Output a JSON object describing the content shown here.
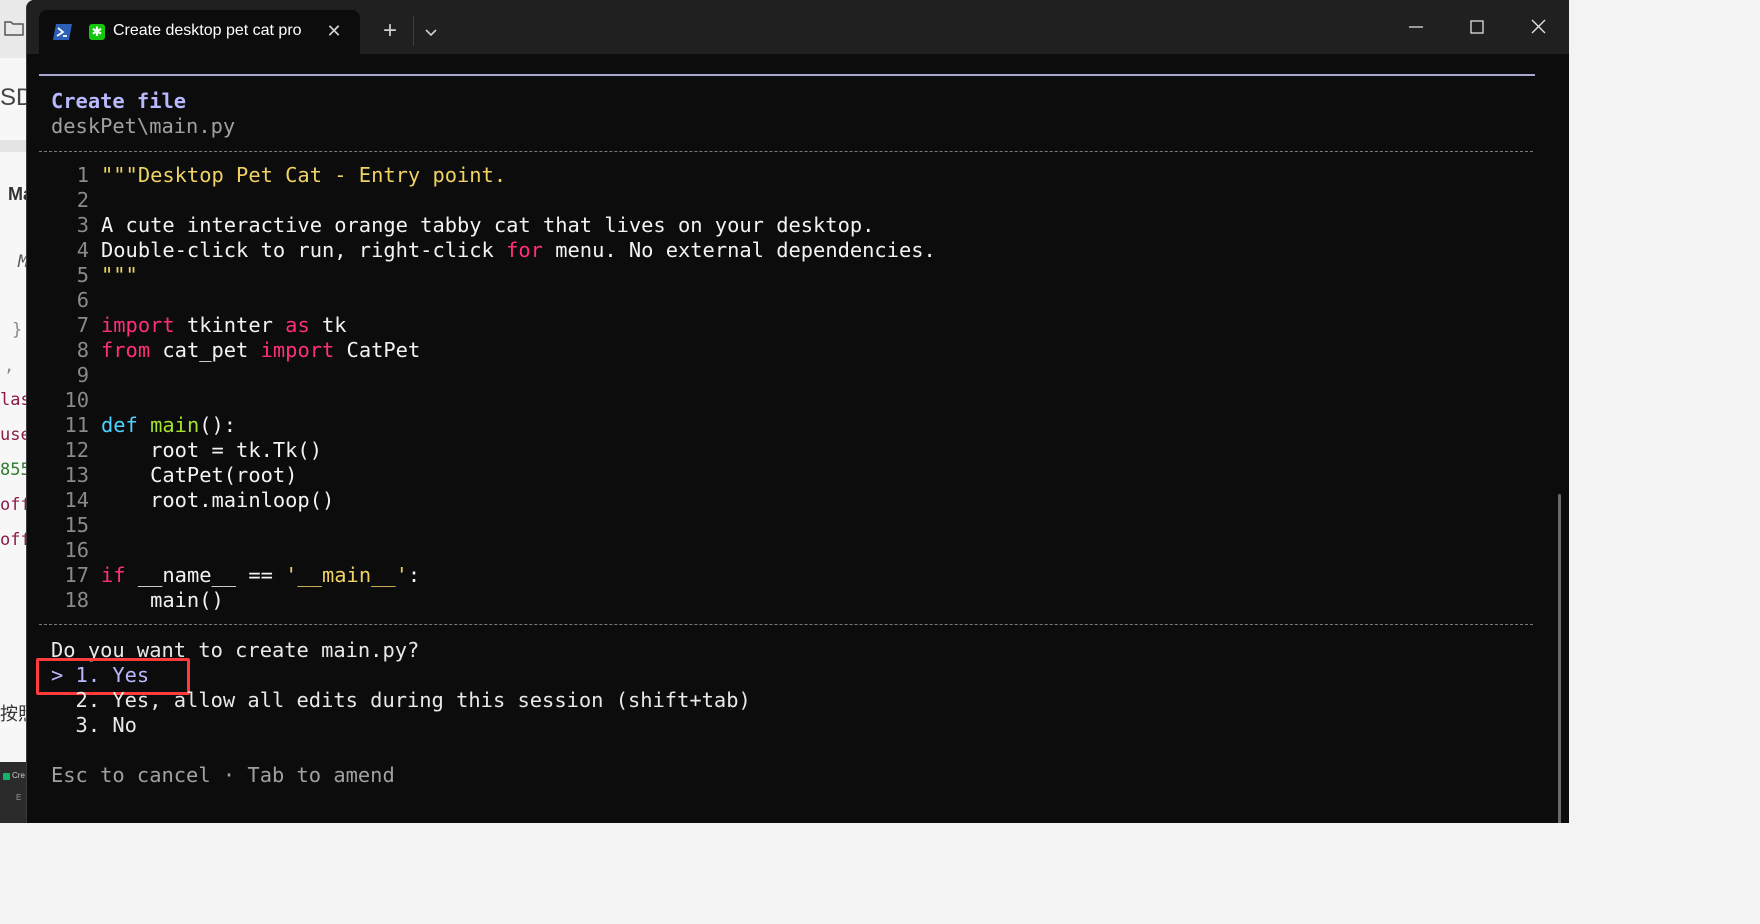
{
  "background_app": {
    "texts": [
      "SD",
      "Ma",
      "M",
      "}",
      ",",
      "las",
      "use",
      "855",
      "off",
      "off",
      "按照",
      "Cre",
      "E"
    ]
  },
  "window": {
    "tab_title": "Create desktop pet cat pro",
    "tab_icon": "powershell-icon",
    "app_icon": "✱",
    "close_tab_glyph": "✕",
    "new_tab_glyph": "+"
  },
  "prompt": {
    "header_title": "Create file",
    "header_path": "deskPet\\main.py",
    "question": "Do you want to create main.py?",
    "options": [
      "> 1. Yes",
      "  2. Yes, allow all edits during this session (shift+tab)",
      "  3. No"
    ],
    "footer": "Esc to cancel · Tab to amend"
  },
  "code": {
    "line_numbers": [
      "1",
      "2",
      "3",
      "4",
      "5",
      "6",
      "7",
      "8",
      "9",
      "10",
      "11",
      "12",
      "13",
      "14",
      "15",
      "16",
      "17",
      "18"
    ],
    "l1": "\"\"\"Desktop Pet Cat - Entry point.",
    "l3": "A cute interactive orange tabby cat that lives on your desktop.",
    "l4a": "Double-click to run, right-click ",
    "l4kw": "for",
    "l4b": " menu. No external dependencies.",
    "l5": "\"\"\"",
    "l7kw1": "import",
    "l7a": " tkinter ",
    "l7kw2": "as",
    "l7b": " tk",
    "l8kw1": "from",
    "l8a": " cat_pet ",
    "l8kw2": "import",
    "l8b": " CatPet",
    "l11def": "def",
    "l11sp": " ",
    "l11fn": "main",
    "l11rest": "():",
    "l12": "    root = tk.Tk()",
    "l13": "    CatPet(root)",
    "l14": "    root.mainloop()",
    "l17kw": "if",
    "l17a": " __name__ == ",
    "l17str": "'__main__'",
    "l17b": ":",
    "l18": "    main()"
  },
  "colors": {
    "terminal_bg": "#0c0c0c",
    "keyword": "#ff2e7a",
    "def_keyword": "#4fd2ff",
    "function": "#a6e22e",
    "string": "#f0d264",
    "accent_purple": "#b8b8ff",
    "highlight_box": "#ff3b3b"
  }
}
